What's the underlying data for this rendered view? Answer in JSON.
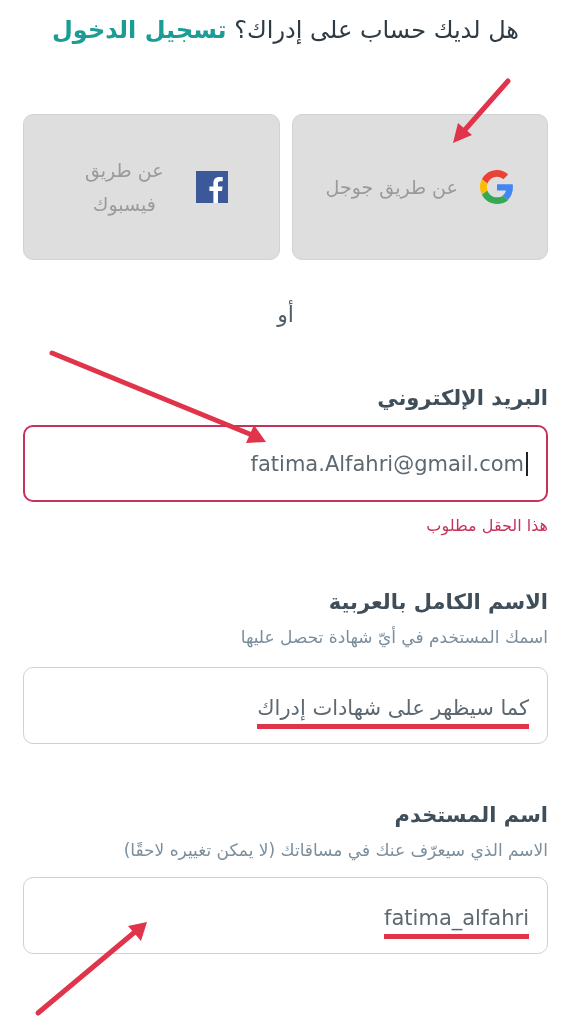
{
  "login_prompt": {
    "question": "هل لديك حساب على إدراك؟",
    "link": "تسجيل الدخول"
  },
  "social_buttons": [
    {
      "kind": "google",
      "label": "عن طريق جوجل"
    },
    {
      "kind": "facebook",
      "label": "عن طريق فيسبوك"
    }
  ],
  "separator": "أو",
  "fields": [
    {
      "label": "البريد الإلكتروني",
      "value": "fatima.Alfahri@gmail.com",
      "focused": true,
      "error": true,
      "error_message": "هذا الحقل مطلوب",
      "underlined": false
    },
    {
      "label": "الاسم الكامل بالعربية",
      "hint": "اسمك المستخدم في أيّ شهادة تحصل عليها",
      "placeholder": "كما سيظهر على شهادات إدراك",
      "focused": false,
      "error": false,
      "underlined": true
    },
    {
      "label": "اسم المستخدم",
      "hint": "الاسم الذي سيعرّف عنك في مساقاتك (لا يمكن تغييره لاحقًا)",
      "value": "fatima_alfahri",
      "focused": false,
      "error": false,
      "underlined": true
    }
  ]
}
